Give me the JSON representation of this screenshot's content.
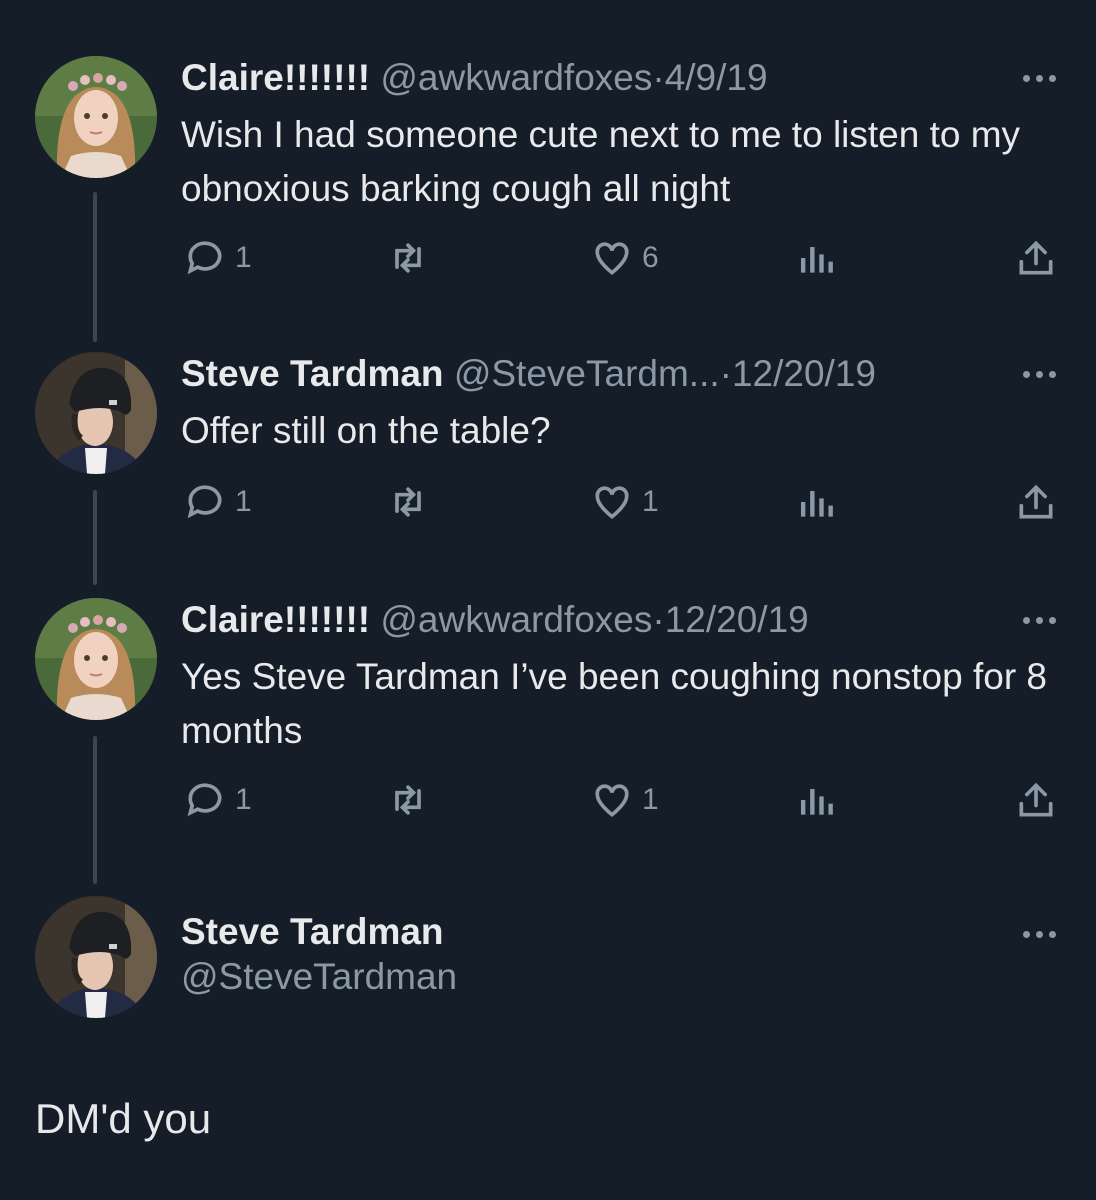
{
  "tweets": [
    {
      "name": "Claire!!!!!!!",
      "handle": "@awkwardfoxes",
      "date": "4/9/19",
      "text": "Wish I had someone cute next to me to listen to my obnoxious barking cough all night",
      "avatar": "claire-avatar",
      "replies": "1",
      "retweets": "",
      "likes": "6"
    },
    {
      "name": "Steve Tardman",
      "handle": "@SteveTardm...",
      "date": "12/20/19",
      "text": "Offer still on the table?",
      "avatar": "steve-avatar",
      "replies": "1",
      "retweets": "",
      "likes": "1"
    },
    {
      "name": "Claire!!!!!!!",
      "handle": "@awkwardfoxes",
      "date": "12/20/19",
      "text": "Yes Steve Tardman I’ve been coughing nonstop for 8 months",
      "avatar": "claire-avatar",
      "replies": "1",
      "retweets": "",
      "likes": "1"
    }
  ],
  "main_tweet": {
    "name": "Steve Tardman",
    "handle": "@SteveTardman",
    "text": "DM'd you",
    "avatar": "steve-avatar"
  },
  "separator": "·",
  "icons": [
    "reply-icon",
    "retweet-icon",
    "like-icon",
    "views-icon",
    "share-icon",
    "more-icon"
  ],
  "colors": {
    "background": "#151d28",
    "text": "#e7e9ea",
    "muted": "#8b98a5",
    "thread_line": "#3b4652"
  }
}
